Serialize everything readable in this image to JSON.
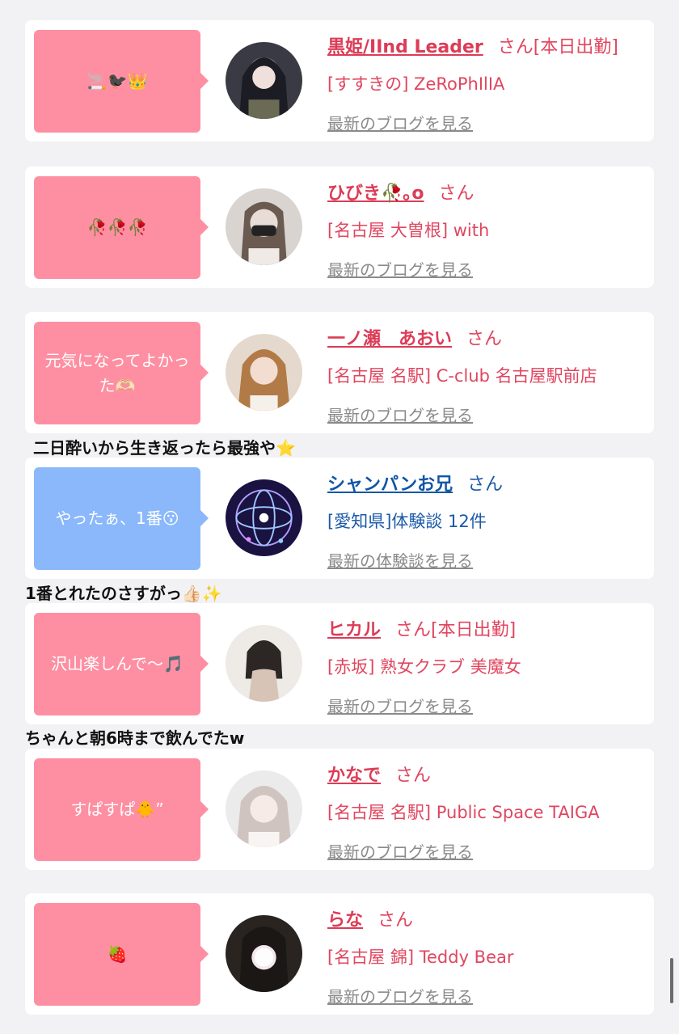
{
  "theme": {
    "pink": "#fe8fa2",
    "blue": "#8ab8fb",
    "name_pink": "#dc3c57",
    "name_blue": "#1256a6",
    "background": "#f2f2f4"
  },
  "cards": [
    {
      "bubble": "🚬🐦‍⬛👑",
      "name": "黒姫/IInd Leader",
      "honor": "さん[本日出勤]",
      "shop": "[すすきの] ZeRoPhIlIA",
      "link": "最新のブログを見る",
      "color": "pink"
    },
    {
      "bubble": "🥀🥀🥀",
      "name": "ひびき🥀｡o",
      "honor": "さん",
      "shop": "[名古屋 大曽根] with",
      "link": "最新のブログを見る",
      "color": "pink"
    },
    {
      "bubble": "元気になってよかった🫶🏻",
      "name": "一ノ瀬　あおい",
      "honor": "さん",
      "shop": "[名古屋 名駅] C-club 名古屋駅前店",
      "link": "最新のブログを見る",
      "color": "pink"
    },
    {
      "bubble": "やったぁ、1番😗",
      "name": "シャンパンお兄",
      "honor": "さん",
      "shop": "[愛知県]体験談 12件",
      "link": "最新の体験談を見る",
      "color": "blue"
    },
    {
      "bubble": "沢山楽しんで〜🎵",
      "name": "ヒカル",
      "honor": "さん[本日出勤]",
      "shop": "[赤坂] 熟女クラブ 美魔女",
      "link": "最新のブログを見る",
      "color": "pink"
    },
    {
      "bubble": "すぱすぱ🐥”",
      "name": "かなで",
      "honor": "さん",
      "shop": "[名古屋 名駅] Public Space TAIGA",
      "link": "最新のブログを見る",
      "color": "pink"
    },
    {
      "bubble": "🍓",
      "name": "らな",
      "honor": "さん",
      "shop": "[名古屋 錦] Teddy Bear",
      "link": "最新のブログを見る",
      "color": "pink"
    }
  ],
  "captions": [
    "二日酔いから生き返ったら最強や⭐️",
    "1番とれたのさすがっ👍🏻✨",
    "ちゃんと朝6時まで飲んでたw"
  ]
}
